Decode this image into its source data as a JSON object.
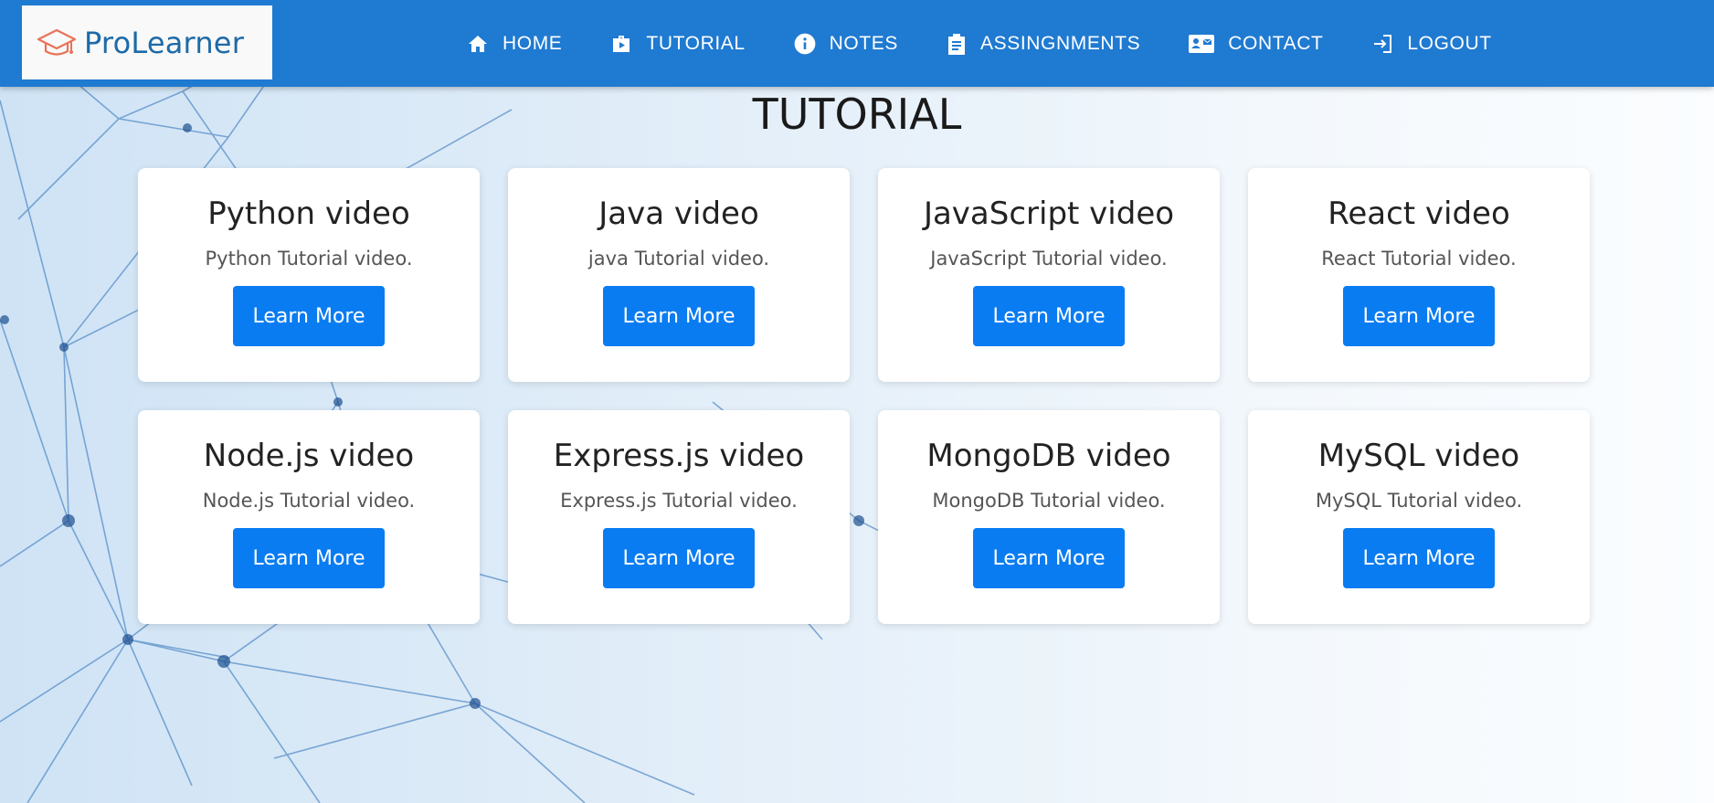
{
  "brand": {
    "name": "ProLearner",
    "icon": "graduation-cap-icon",
    "color": "#1e6aa8"
  },
  "nav": {
    "background": "#1f7ad1",
    "items": [
      {
        "label": "HOME",
        "icon": "home-icon"
      },
      {
        "label": "TUTORIAL",
        "icon": "briefcase-play-icon"
      },
      {
        "label": "NOTES",
        "icon": "info-icon"
      },
      {
        "label": "ASSINGNMENTS",
        "icon": "clipboard-icon"
      },
      {
        "label": "CONTACT",
        "icon": "contact-card-icon"
      },
      {
        "label": "LOGOUT",
        "icon": "logout-icon"
      }
    ]
  },
  "page": {
    "title": "TUTORIAL"
  },
  "cards": [
    {
      "title": "Python video",
      "text": "Python Tutorial video.",
      "button": "Learn More"
    },
    {
      "title": "Java video",
      "text": "java Tutorial video.",
      "button": "Learn More"
    },
    {
      "title": "JavaScript video",
      "text": "JavaScript Tutorial video.",
      "button": "Learn More"
    },
    {
      "title": "React video",
      "text": "React Tutorial video.",
      "button": "Learn More"
    },
    {
      "title": "Node.js video",
      "text": "Node.js Tutorial video.",
      "button": "Learn More"
    },
    {
      "title": "Express.js video",
      "text": "Express.js Tutorial video.",
      "button": "Learn More"
    },
    {
      "title": "MongoDB video",
      "text": "MongoDB Tutorial video.",
      "button": "Learn More"
    },
    {
      "title": "MySQL video",
      "text": "MySQL Tutorial video.",
      "button": "Learn More"
    }
  ],
  "colors": {
    "button": "#0a7cf2",
    "card": "#ffffff"
  }
}
